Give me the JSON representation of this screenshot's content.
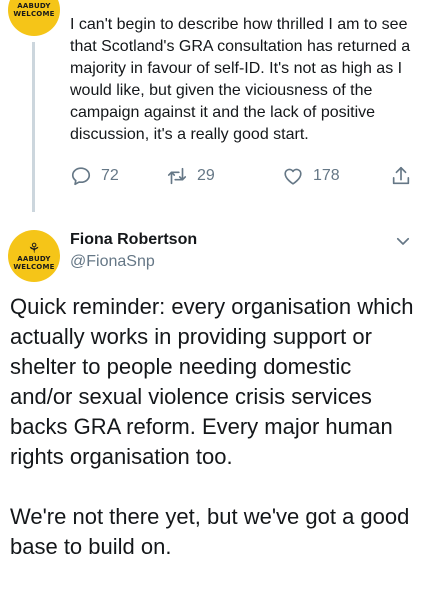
{
  "tweet1": {
    "avatar_text": [
      "AABUDY",
      "WELCOME"
    ],
    "text": "I can't begin to describe how thrilled I am to see that Scotland's GRA consultation has returned a majority in favour of self-ID. It's not as high as I would like, but given the viciousness of the campaign against it and the lack of positive discussion, it's a really good start.",
    "reply_count": "72",
    "retweet_count": "29",
    "like_count": "178",
    "icons": [
      "reply-icon",
      "retweet-icon",
      "like-icon",
      "share-icon"
    ]
  },
  "tweet2": {
    "avatar_text": [
      "AABUDY",
      "WELCOME"
    ],
    "author_name": "Fiona Robertson",
    "author_handle": "@FionaSnp",
    "paragraphs": [
      "Quick reminder: every organisation which actually works in providing support or shelter to people needing domestic and/or sexual violence crisis services backs GRA reform. Every major human rights organisation too.",
      "We're not there yet, but we've got a good base to build on."
    ],
    "menu_icon": "chevron-down-icon"
  },
  "colors": {
    "text": "#14171a",
    "secondary": "#657786",
    "avatar_bg": "#f5c518",
    "thread_line": "#ccd6dd"
  }
}
